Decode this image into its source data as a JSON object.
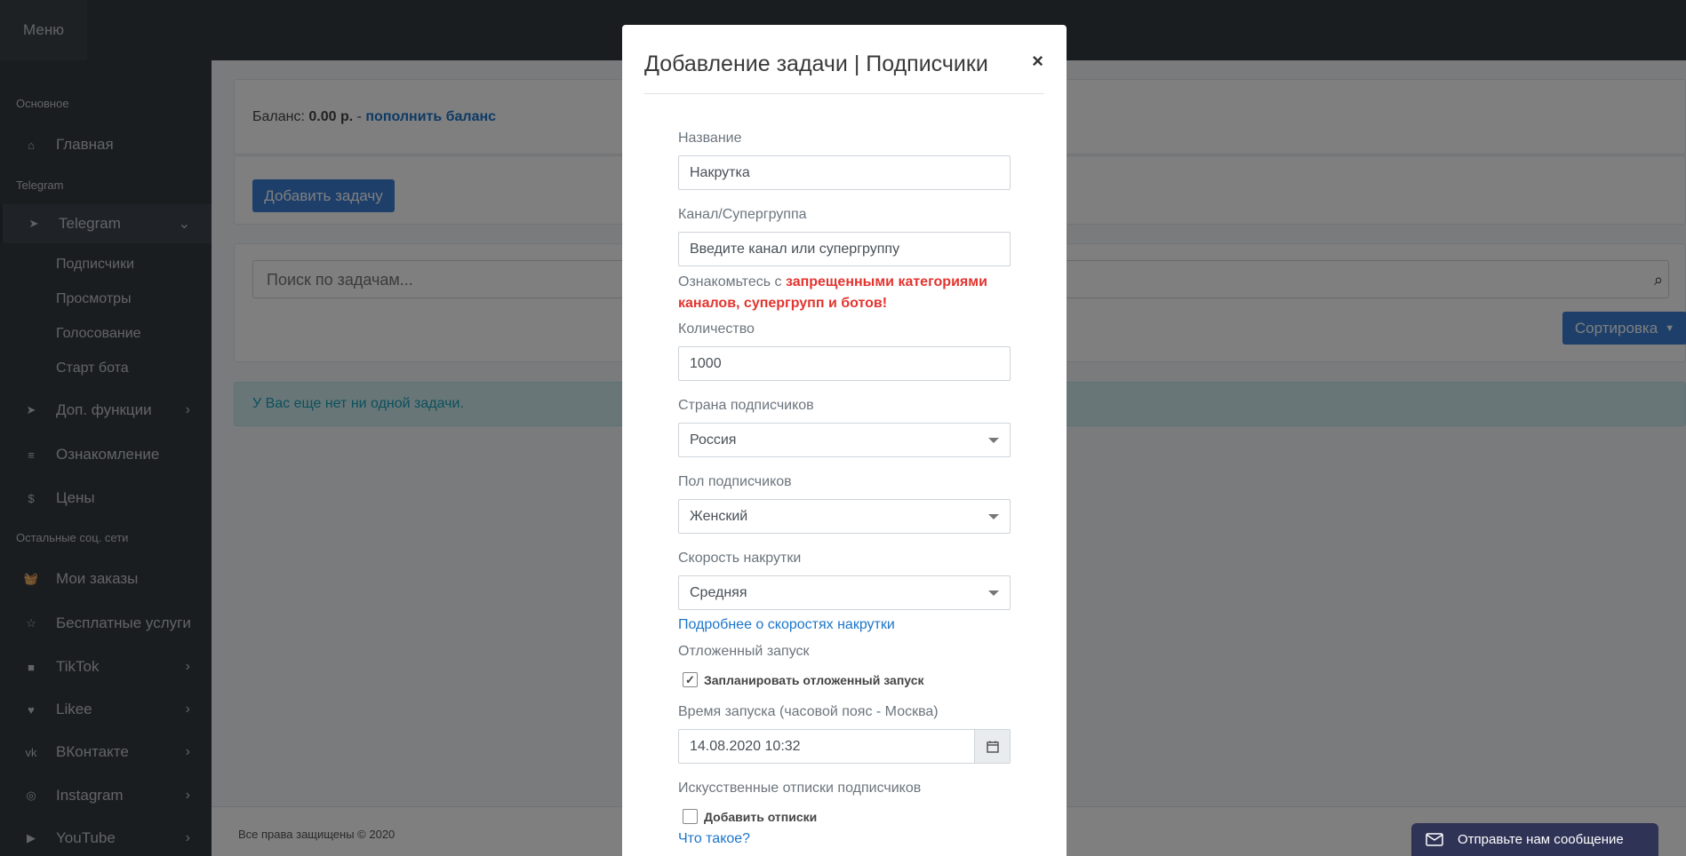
{
  "topbar": {
    "menu_label": "Меню"
  },
  "sidebar": {
    "section_main": "Основное",
    "home": "Главная",
    "section_telegram": "Telegram",
    "telegram": "Telegram",
    "telegram_sub": [
      "Подписчики",
      "Просмотры",
      "Голосование",
      "Старт бота"
    ],
    "extra": "Доп. функции",
    "intro": "Ознакомление",
    "prices": "Цены",
    "section_other": "Остальные соц. сети",
    "orders": "Мои заказы",
    "free": "Бесплатные услуги",
    "tiktok": "TikTok",
    "likee": "Likee",
    "vk": "ВКонтакте",
    "instagram": "Instagram",
    "youtube": "YouTube"
  },
  "main": {
    "balance_prefix": "Баланс: ",
    "balance_value": "0.00 р.",
    "balance_sep": " - ",
    "balance_link": "пополнить баланс",
    "add_task": "Добавить задачу",
    "search_placeholder": "Поиск по задачам...",
    "sort_label": "Сортировка",
    "empty_notice": "У Вас еще нет ни одной задачи.",
    "footer": "Все права защищены © 2020"
  },
  "modal": {
    "title": "Добавление задачи | Подписчики",
    "close": "×",
    "name_label": "Название",
    "name_value": "Накрутка",
    "channel_label": "Канал/Супергруппа",
    "channel_placeholder": "Введите канал или супергруппу",
    "warn_prefix": "Ознакомьтесь с ",
    "warn_bold": "запрещенными категориями каналов, супергрупп и ботов!",
    "qty_label": "Количество",
    "qty_value": "1000",
    "country_label": "Страна подписчиков",
    "country_value": "Россия",
    "gender_label": "Пол подписчиков",
    "gender_value": "Женский",
    "speed_label": "Скорость накрутки",
    "speed_value": "Средняя",
    "speed_link": "Подробнее о скоростях накрутки",
    "delayed_label": "Отложенный запуск",
    "delayed_check": "Запланировать отложенный запуск",
    "time_label": "Время запуска (часовой пояс - Москва)",
    "time_value": "14.08.2020 10:32",
    "unsub_label": "Искусственные отписки подписчиков",
    "unsub_check": "Добавить отписки",
    "what_link": "Что такое?"
  },
  "chat": {
    "label": "Отправьте нам сообщение"
  }
}
